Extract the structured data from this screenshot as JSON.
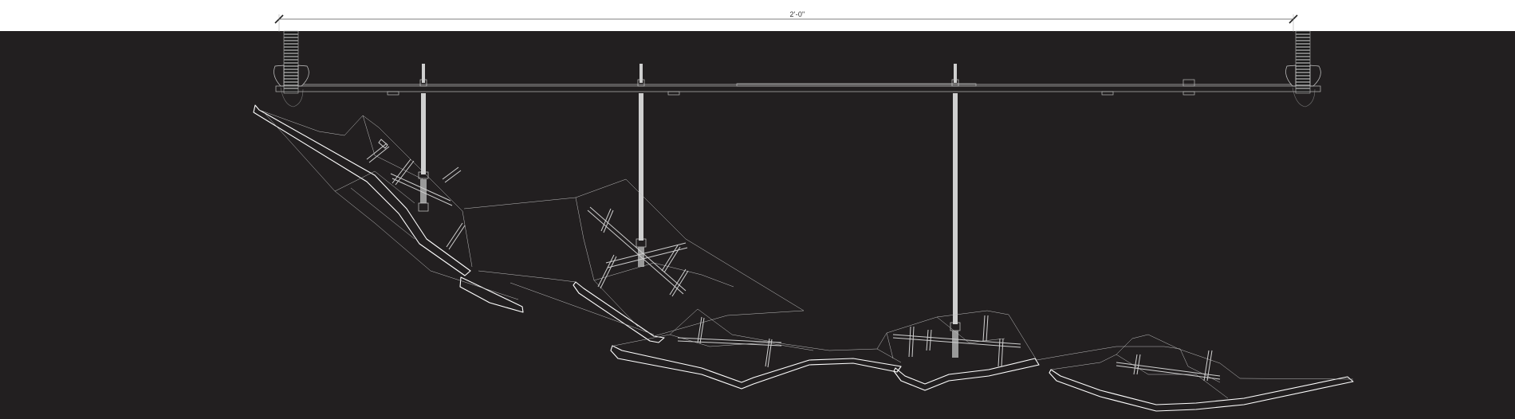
{
  "dimension": {
    "label": "2'-0\""
  },
  "colors": {
    "background": "#221f20",
    "line": "#ffffff",
    "hardware": "#cfcfcf",
    "dimension_line": "#555555"
  }
}
